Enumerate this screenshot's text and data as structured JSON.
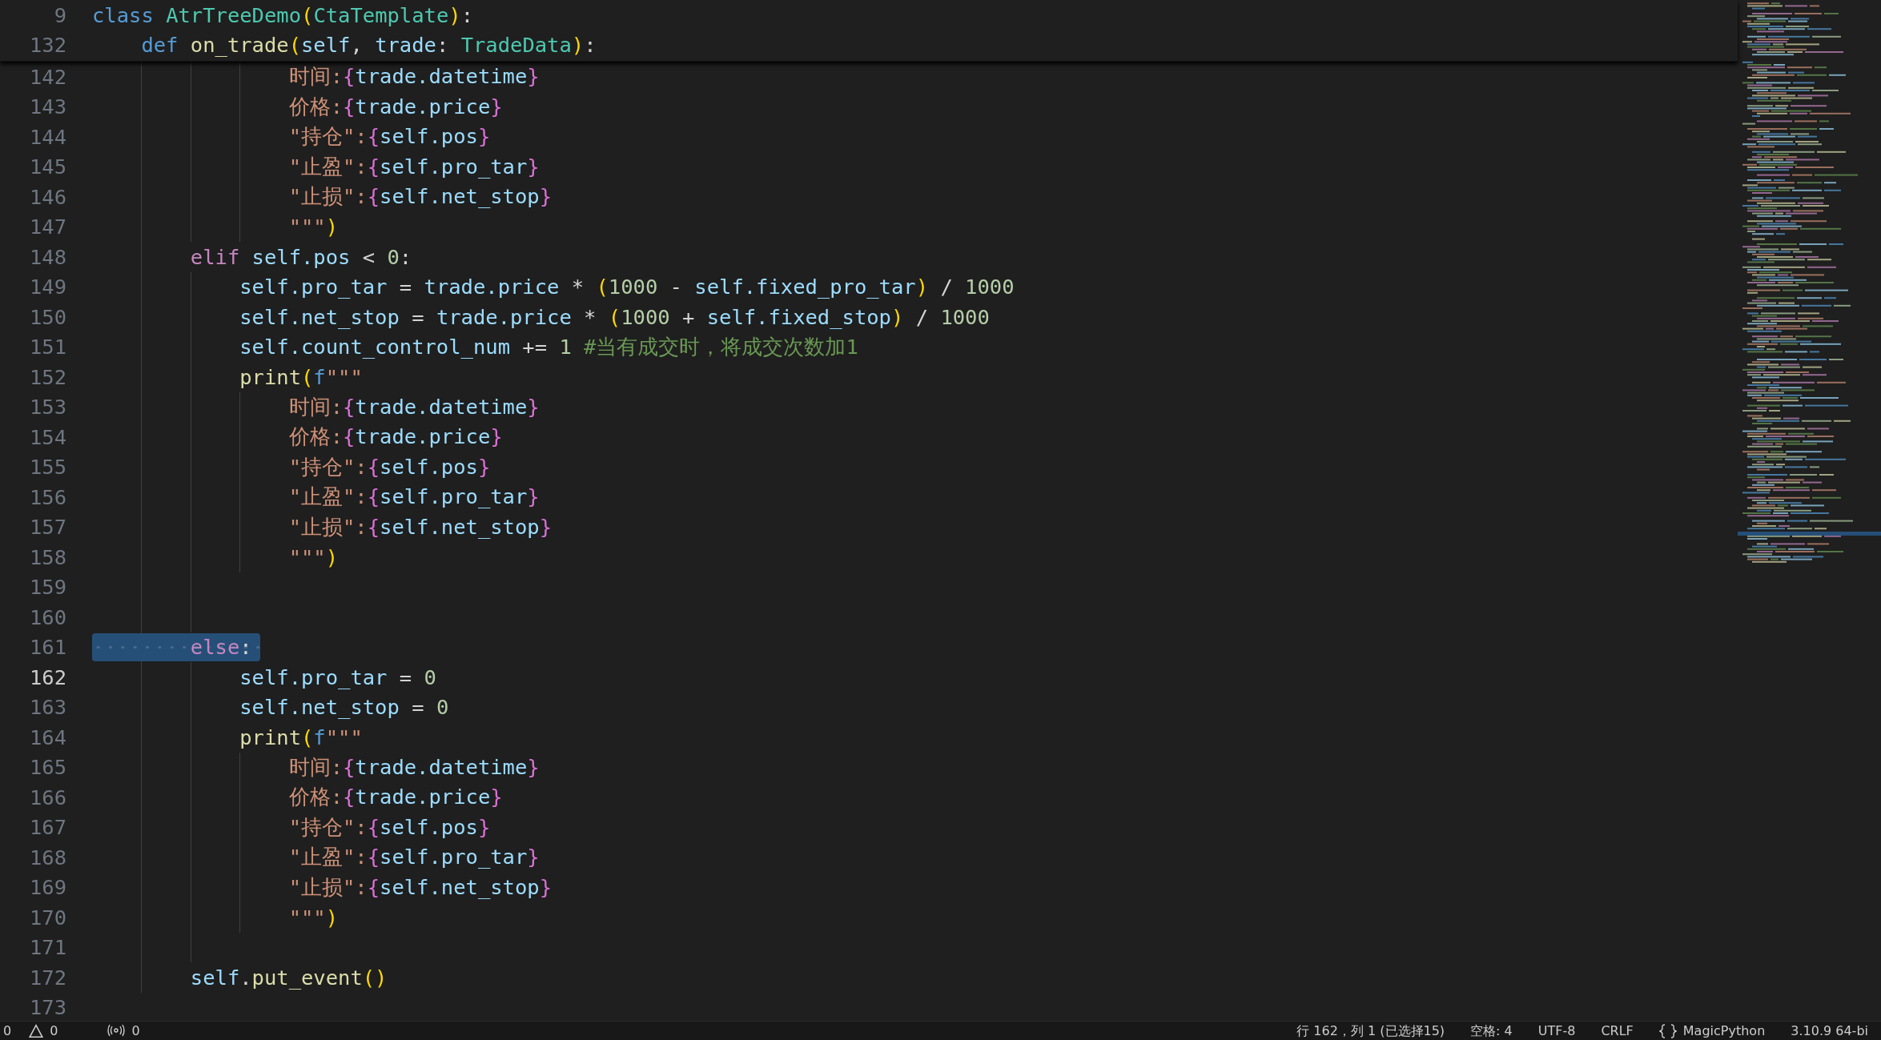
{
  "sticky": [
    {
      "number": "9",
      "tokens": [
        {
          "text": "class ",
          "kind": "kw"
        },
        {
          "text": "AtrTreeDemo",
          "kind": "type"
        },
        {
          "text": "(",
          "kind": "paren"
        },
        {
          "text": "CtaTemplate",
          "kind": "type"
        },
        {
          "text": ")",
          "kind": "paren"
        },
        {
          "text": ":",
          "kind": "op"
        }
      ]
    },
    {
      "number": "132",
      "tokens": [
        {
          "text": "    def ",
          "kind": "kw"
        },
        {
          "text": "on_trade",
          "kind": "fn"
        },
        {
          "text": "(",
          "kind": "paren"
        },
        {
          "text": "self",
          "kind": "var"
        },
        {
          "text": ", ",
          "kind": "op"
        },
        {
          "text": "trade",
          "kind": "var"
        },
        {
          "text": ": ",
          "kind": "op"
        },
        {
          "text": "TradeData",
          "kind": "type"
        },
        {
          "text": ")",
          "kind": "paren"
        },
        {
          "text": ":",
          "kind": "op"
        }
      ]
    }
  ],
  "lines": [
    {
      "number": "142",
      "selected": false,
      "current": false,
      "tokens": [
        {
          "text": "                时间:",
          "kind": "str"
        },
        {
          "text": "{",
          "kind": "brace"
        },
        {
          "text": "trade.datetime",
          "kind": "var"
        },
        {
          "text": "}",
          "kind": "brace"
        }
      ]
    },
    {
      "number": "143",
      "selected": false,
      "current": false,
      "tokens": [
        {
          "text": "                价格:",
          "kind": "str"
        },
        {
          "text": "{",
          "kind": "brace"
        },
        {
          "text": "trade.price",
          "kind": "var"
        },
        {
          "text": "}",
          "kind": "brace"
        }
      ]
    },
    {
      "number": "144",
      "selected": false,
      "current": false,
      "tokens": [
        {
          "text": "                \"持仓\":",
          "kind": "str"
        },
        {
          "text": "{",
          "kind": "brace"
        },
        {
          "text": "self.pos",
          "kind": "var"
        },
        {
          "text": "}",
          "kind": "brace"
        }
      ]
    },
    {
      "number": "145",
      "selected": false,
      "current": false,
      "tokens": [
        {
          "text": "                \"止盈\":",
          "kind": "str"
        },
        {
          "text": "{",
          "kind": "brace"
        },
        {
          "text": "self.pro_tar",
          "kind": "var"
        },
        {
          "text": "}",
          "kind": "brace"
        }
      ]
    },
    {
      "number": "146",
      "selected": false,
      "current": false,
      "tokens": [
        {
          "text": "                \"止损\":",
          "kind": "str"
        },
        {
          "text": "{",
          "kind": "brace"
        },
        {
          "text": "self.net_stop",
          "kind": "var"
        },
        {
          "text": "}",
          "kind": "brace"
        }
      ]
    },
    {
      "number": "147",
      "selected": false,
      "current": false,
      "tokens": [
        {
          "text": "                \"\"\"",
          "kind": "str"
        },
        {
          "text": ")",
          "kind": "paren"
        }
      ]
    },
    {
      "number": "148",
      "selected": false,
      "current": false,
      "tokens": [
        {
          "text": "        elif",
          "kind": "ctrl"
        },
        {
          "text": " self.pos",
          "kind": "var"
        },
        {
          "text": " < ",
          "kind": "op"
        },
        {
          "text": "0",
          "kind": "num"
        },
        {
          "text": ":",
          "kind": "op"
        }
      ]
    },
    {
      "number": "149",
      "selected": false,
      "current": false,
      "tokens": [
        {
          "text": "            self.pro_tar",
          "kind": "var"
        },
        {
          "text": " = ",
          "kind": "op"
        },
        {
          "text": "trade.price",
          "kind": "var"
        },
        {
          "text": " * ",
          "kind": "op"
        },
        {
          "text": "(",
          "kind": "paren"
        },
        {
          "text": "1000",
          "kind": "num"
        },
        {
          "text": " - ",
          "kind": "op"
        },
        {
          "text": "self.fixed_pro_tar",
          "kind": "var"
        },
        {
          "text": ")",
          "kind": "paren"
        },
        {
          "text": " / ",
          "kind": "op"
        },
        {
          "text": "1000",
          "kind": "num"
        }
      ]
    },
    {
      "number": "150",
      "selected": false,
      "current": false,
      "tokens": [
        {
          "text": "            self.net_stop",
          "kind": "var"
        },
        {
          "text": " = ",
          "kind": "op"
        },
        {
          "text": "trade.price",
          "kind": "var"
        },
        {
          "text": " * ",
          "kind": "op"
        },
        {
          "text": "(",
          "kind": "paren"
        },
        {
          "text": "1000",
          "kind": "num"
        },
        {
          "text": " + ",
          "kind": "op"
        },
        {
          "text": "self.fixed_stop",
          "kind": "var"
        },
        {
          "text": ")",
          "kind": "paren"
        },
        {
          "text": " / ",
          "kind": "op"
        },
        {
          "text": "1000",
          "kind": "num"
        }
      ]
    },
    {
      "number": "151",
      "selected": false,
      "current": false,
      "tokens": [
        {
          "text": "            self.count_control_num",
          "kind": "var"
        },
        {
          "text": " += ",
          "kind": "op"
        },
        {
          "text": "1",
          "kind": "num"
        },
        {
          "text": " #当有成交时，将成交次数加1",
          "kind": "comment"
        }
      ]
    },
    {
      "number": "152",
      "selected": false,
      "current": false,
      "tokens": [
        {
          "text": "            print",
          "kind": "fn"
        },
        {
          "text": "(",
          "kind": "paren"
        },
        {
          "text": "f",
          "kind": "kw"
        },
        {
          "text": "\"\"\"",
          "kind": "str"
        }
      ]
    },
    {
      "number": "153",
      "selected": false,
      "current": false,
      "tokens": [
        {
          "text": "                时间:",
          "kind": "str"
        },
        {
          "text": "{",
          "kind": "brace"
        },
        {
          "text": "trade.datetime",
          "kind": "var"
        },
        {
          "text": "}",
          "kind": "brace"
        }
      ]
    },
    {
      "number": "154",
      "selected": false,
      "current": false,
      "tokens": [
        {
          "text": "                价格:",
          "kind": "str"
        },
        {
          "text": "{",
          "kind": "brace"
        },
        {
          "text": "trade.price",
          "kind": "var"
        },
        {
          "text": "}",
          "kind": "brace"
        }
      ]
    },
    {
      "number": "155",
      "selected": false,
      "current": false,
      "tokens": [
        {
          "text": "                \"持仓\":",
          "kind": "str"
        },
        {
          "text": "{",
          "kind": "brace"
        },
        {
          "text": "self.pos",
          "kind": "var"
        },
        {
          "text": "}",
          "kind": "brace"
        }
      ]
    },
    {
      "number": "156",
      "selected": false,
      "current": false,
      "tokens": [
        {
          "text": "                \"止盈\":",
          "kind": "str"
        },
        {
          "text": "{",
          "kind": "brace"
        },
        {
          "text": "self.pro_tar",
          "kind": "var"
        },
        {
          "text": "}",
          "kind": "brace"
        }
      ]
    },
    {
      "number": "157",
      "selected": false,
      "current": false,
      "tokens": [
        {
          "text": "                \"止损\":",
          "kind": "str"
        },
        {
          "text": "{",
          "kind": "brace"
        },
        {
          "text": "self.net_stop",
          "kind": "var"
        },
        {
          "text": "}",
          "kind": "brace"
        }
      ]
    },
    {
      "number": "158",
      "selected": false,
      "current": false,
      "tokens": [
        {
          "text": "                \"\"\"",
          "kind": "str"
        },
        {
          "text": ")",
          "kind": "paren"
        }
      ]
    },
    {
      "number": "159",
      "selected": false,
      "current": false
    },
    {
      "number": "160",
      "selected": false,
      "current": false
    },
    {
      "number": "161",
      "selected": true,
      "current": false,
      "tokens": [
        {
          "text": "        else",
          "kind": "ctrl"
        },
        {
          "text": ":",
          "kind": "op"
        }
      ]
    },
    {
      "number": "162",
      "selected": false,
      "current": true,
      "tokens": [
        {
          "text": "            self.pro_tar",
          "kind": "var"
        },
        {
          "text": " = ",
          "kind": "op"
        },
        {
          "text": "0",
          "kind": "num"
        }
      ]
    },
    {
      "number": "163",
      "selected": false,
      "current": false,
      "tokens": [
        {
          "text": "            self.net_stop",
          "kind": "var"
        },
        {
          "text": " = ",
          "kind": "op"
        },
        {
          "text": "0",
          "kind": "num"
        }
      ]
    },
    {
      "number": "164",
      "selected": false,
      "current": false,
      "tokens": [
        {
          "text": "            print",
          "kind": "fn"
        },
        {
          "text": "(",
          "kind": "paren"
        },
        {
          "text": "f",
          "kind": "kw"
        },
        {
          "text": "\"\"\"",
          "kind": "str"
        }
      ]
    },
    {
      "number": "165",
      "selected": false,
      "current": false,
      "tokens": [
        {
          "text": "                时间:",
          "kind": "str"
        },
        {
          "text": "{",
          "kind": "brace"
        },
        {
          "text": "trade.datetime",
          "kind": "var"
        },
        {
          "text": "}",
          "kind": "brace"
        }
      ]
    },
    {
      "number": "166",
      "selected": false,
      "current": false,
      "tokens": [
        {
          "text": "                价格:",
          "kind": "str"
        },
        {
          "text": "{",
          "kind": "brace"
        },
        {
          "text": "trade.price",
          "kind": "var"
        },
        {
          "text": "}",
          "kind": "brace"
        }
      ]
    },
    {
      "number": "167",
      "selected": false,
      "current": false,
      "tokens": [
        {
          "text": "                \"持仓\":",
          "kind": "str"
        },
        {
          "text": "{",
          "kind": "brace"
        },
        {
          "text": "self.pos",
          "kind": "var"
        },
        {
          "text": "}",
          "kind": "brace"
        }
      ]
    },
    {
      "number": "168",
      "selected": false,
      "current": false,
      "tokens": [
        {
          "text": "                \"止盈\":",
          "kind": "str"
        },
        {
          "text": "{",
          "kind": "brace"
        },
        {
          "text": "self.pro_tar",
          "kind": "var"
        },
        {
          "text": "}",
          "kind": "brace"
        }
      ]
    },
    {
      "number": "169",
      "selected": false,
      "current": false,
      "tokens": [
        {
          "text": "                \"止损\":",
          "kind": "str"
        },
        {
          "text": "{",
          "kind": "brace"
        },
        {
          "text": "self.net_stop",
          "kind": "var"
        },
        {
          "text": "}",
          "kind": "brace"
        }
      ]
    },
    {
      "number": "170",
      "selected": false,
      "current": false,
      "tokens": [
        {
          "text": "                \"\"\"",
          "kind": "str"
        },
        {
          "text": ")",
          "kind": "paren"
        }
      ]
    },
    {
      "number": "171",
      "selected": false,
      "current": false
    },
    {
      "number": "172",
      "selected": false,
      "current": false,
      "tokens": [
        {
          "text": "        self",
          "kind": "var"
        },
        {
          "text": ".",
          "kind": "op"
        },
        {
          "text": "put_event",
          "kind": "fn"
        },
        {
          "text": "()",
          "kind": "paren"
        }
      ]
    },
    {
      "number": "173",
      "selected": false,
      "current": false
    }
  ],
  "status_bar": {
    "errors": "0",
    "warnings": "0",
    "ports": "0",
    "position": "行 162，列 1 (已选择15)",
    "indent": "空格: 4",
    "encoding": "UTF-8",
    "eol": "CRLF",
    "language": "MagicPython",
    "interpreter": "3.10.9 64-bi"
  }
}
